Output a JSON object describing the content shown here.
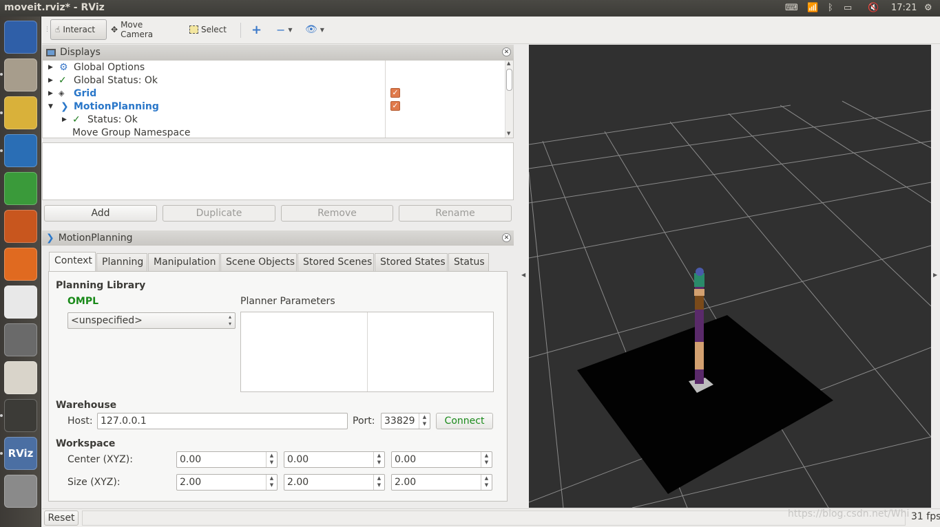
{
  "window": {
    "title": "moveit.rviz* - RViz"
  },
  "tray": {
    "time": "17:21"
  },
  "launcher": {
    "apps": [
      {
        "icon": "ubuntu-dash-icon",
        "color": "#2f5fa8"
      },
      {
        "icon": "files-icon",
        "color": "#a79d8c"
      },
      {
        "icon": "chrome-icon",
        "color": "#d9b13a"
      },
      {
        "icon": "writer-icon",
        "color": "#2a6eb5"
      },
      {
        "icon": "calc-icon",
        "color": "#3a9a3a"
      },
      {
        "icon": "impress-icon",
        "color": "#c8561e"
      },
      {
        "icon": "software-center-icon",
        "color": "#e06a20"
      },
      {
        "icon": "amazon-icon",
        "color": "#e8e8e8"
      },
      {
        "icon": "settings-icon",
        "color": "#6a6a6a"
      },
      {
        "icon": "document-viewer-icon",
        "color": "#d9d4ca"
      },
      {
        "icon": "terminal-icon",
        "color": "#3c3b37"
      },
      {
        "icon": "rviz-icon",
        "color": "#4b6fa3"
      },
      {
        "icon": "workspaces-icon",
        "color": "#8a8a8a"
      }
    ],
    "rviz_label": "RViz"
  },
  "toolbar": {
    "interact": "Interact",
    "move_camera": "Move Camera",
    "select": "Select"
  },
  "displays": {
    "title": "Displays",
    "items": [
      {
        "label": "Global Options"
      },
      {
        "label": "Global Status: Ok"
      },
      {
        "label": "Grid"
      },
      {
        "label": "MotionPlanning"
      },
      {
        "label": "Status: Ok"
      },
      {
        "label": "Move Group Namespace"
      }
    ],
    "buttons": {
      "add": "Add",
      "duplicate": "Duplicate",
      "remove": "Remove",
      "rename": "Rename"
    }
  },
  "motion_planning": {
    "title": "MotionPlanning",
    "tabs": [
      "Context",
      "Planning",
      "Manipulation",
      "Scene Objects",
      "Stored Scenes",
      "Stored States",
      "Status"
    ],
    "planning_library_label": "Planning Library",
    "library_name": "OMPL",
    "planner_select": "<unspecified>",
    "planner_params_label": "Planner Parameters",
    "warehouse_label": "Warehouse",
    "host_label": "Host:",
    "host_value": "127.0.0.1",
    "port_label": "Port:",
    "port_value": "33829",
    "connect": "Connect",
    "workspace_label": "Workspace",
    "center_label": "Center (XYZ):",
    "center": [
      "0.00",
      "0.00",
      "0.00"
    ],
    "size_label": "Size (XYZ):",
    "size": [
      "2.00",
      "2.00",
      "2.00"
    ]
  },
  "status": {
    "reset": "Reset",
    "fps": "31 fps",
    "watermark": "https://blog.csdn.net/Whi"
  },
  "colors": {
    "accent_blue": "#2a77c9",
    "ompl_green": "#1a8a1a",
    "checkbox": "#e07a4b"
  }
}
